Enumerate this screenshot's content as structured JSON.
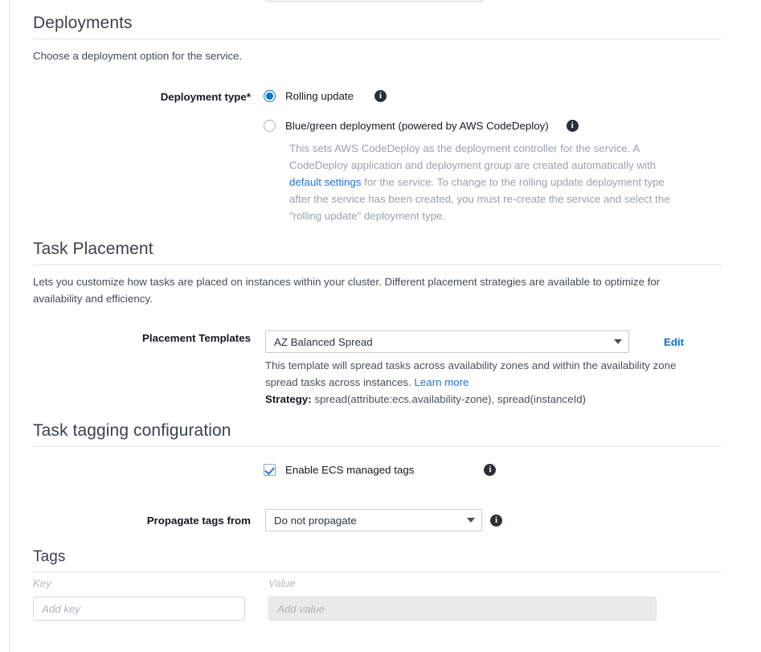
{
  "top_clipped_field": {
    "name": "clipped-input-above"
  },
  "deployments": {
    "title": "Deployments",
    "description": "Choose a deployment option for the service.",
    "deployment_type_label": "Deployment type*",
    "options": [
      {
        "label": "Rolling update",
        "selected": true,
        "info": "info-icon"
      },
      {
        "label": "Blue/green deployment (powered by AWS CodeDeploy)",
        "selected": false,
        "info": "info-icon"
      }
    ],
    "bluegreen_help_part1": "This sets AWS CodeDeploy as the deployment controller for the service. A CodeDeploy application and deployment group are created automatically with ",
    "bluegreen_help_link": "default settings",
    "bluegreen_help_part2": " for the service. To change to the rolling update deployment type after the service has been created, you must re-create the service and select the \"rolling update\" deployment type."
  },
  "task_placement": {
    "title": "Task Placement",
    "description": "Lets you customize how tasks are placed on instances within your cluster. Different placement strategies are available to optimize for availability and efficiency.",
    "placement_templates_label": "Placement Templates",
    "placement_templates_value": "AZ Balanced Spread",
    "edit_label": "Edit",
    "helper_part1": "This template will spread tasks across availability zones and within the availability zone spread tasks across instances. ",
    "helper_link": "Learn more",
    "strategy_label": "Strategy:",
    "strategy_value": "spread(attribute:ecs.availability-zone), spread(instanceId)"
  },
  "task_tagging": {
    "title": "Task tagging configuration",
    "enable_managed_tags_label": "Enable ECS managed tags",
    "enable_managed_tags_checked": true,
    "propagate_label": "Propagate tags from",
    "propagate_value": "Do not propagate"
  },
  "tags": {
    "title": "Tags",
    "key_column_label": "Key",
    "value_column_label": "Value",
    "key_placeholder": "Add key",
    "key_value": "",
    "value_placeholder": "Add value",
    "value_value": ""
  },
  "colors": {
    "accent_blue": "#0a73cc",
    "link_blue": "#2074d5",
    "muted_text": "#9aa2ab",
    "heading": "#3b424b",
    "rule": "#e2e2e2",
    "disabled_field": "#eaeaea"
  }
}
